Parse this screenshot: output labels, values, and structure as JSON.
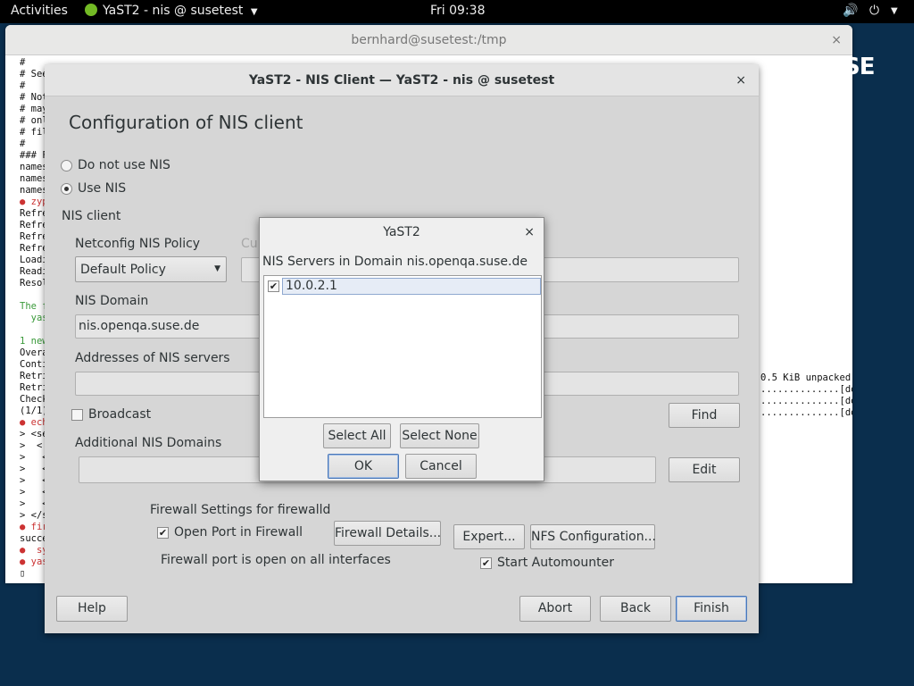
{
  "topbar": {
    "activities": "Activities",
    "app_name": "YaST2 - nis @ susetest",
    "clock": "Fri 09:38"
  },
  "terminal": {
    "title": "bernhard@susetest:/tmp",
    "close": "×",
    "lines": [
      {
        "t": "#",
        "c": ""
      },
      {
        "t": "# See",
        "c": ""
      },
      {
        "t": "#",
        "c": ""
      },
      {
        "t": "# Not",
        "c": ""
      },
      {
        "t": "# may",
        "c": ""
      },
      {
        "t": "# onl",
        "c": ""
      },
      {
        "t": "# fil",
        "c": ""
      },
      {
        "t": "#",
        "c": ""
      },
      {
        "t": "### F",
        "c": ""
      },
      {
        "t": "names",
        "c": ""
      },
      {
        "t": "names",
        "c": ""
      },
      {
        "t": "names",
        "c": ""
      },
      {
        "t": "● zyp",
        "c": "red"
      },
      {
        "t": "Refre",
        "c": ""
      },
      {
        "t": "Refre",
        "c": ""
      },
      {
        "t": "Refre",
        "c": ""
      },
      {
        "t": "Refre",
        "c": ""
      },
      {
        "t": "Loadi",
        "c": ""
      },
      {
        "t": "Readi",
        "c": ""
      },
      {
        "t": "Resol",
        "c": ""
      },
      {
        "t": "",
        "c": ""
      },
      {
        "t": "The f",
        "c": "green"
      },
      {
        "t": "  yas",
        "c": "green"
      },
      {
        "t": "",
        "c": ""
      },
      {
        "t": "1 new",
        "c": "green"
      },
      {
        "t": "Overa",
        "c": ""
      },
      {
        "t": "Conti",
        "c": ""
      },
      {
        "t": "Retri",
        "c": ""
      },
      {
        "t": "Retri",
        "c": ""
      },
      {
        "t": "Check",
        "c": ""
      },
      {
        "t": "(1/1)",
        "c": ""
      },
      {
        "t": "● ech",
        "c": "red"
      },
      {
        "t": "> <se",
        "c": ""
      },
      {
        "t": ">  <",
        "c": ""
      },
      {
        "t": ">   <",
        "c": ""
      },
      {
        "t": ">   <",
        "c": ""
      },
      {
        "t": ">   <",
        "c": ""
      },
      {
        "t": ">   <",
        "c": ""
      },
      {
        "t": ">   <",
        "c": ""
      },
      {
        "t": "> </s",
        "c": ""
      },
      {
        "t": "● fir",
        "c": "red"
      },
      {
        "t": "succe",
        "c": ""
      },
      {
        "t": "●  sy",
        "c": "red"
      },
      {
        "t": "● yas",
        "c": "red"
      },
      {
        "t": "▯",
        "c": ""
      }
    ],
    "right_lines": "0.5 KiB unpacked)\n..............[done]\n..............[done]\n..............[done]",
    "logo": "SE"
  },
  "yast": {
    "title": "YaST2 - NIS Client — YaST2 - nis @ susetest",
    "close": "×",
    "heading": "Configuration of NIS client",
    "radio_no_nis": "Do not use NIS",
    "radio_use_nis": "Use NIS",
    "nis_client_label": "NIS client",
    "netconfig_label": "Netconfig NIS Policy",
    "netconfig_value": "Default Policy",
    "custom_label": "Cu",
    "nis_domain_label": "NIS Domain",
    "nis_domain_value": "nis.openqa.suse.de",
    "addresses_label": "Addresses of NIS servers",
    "broadcast_label": "Broadcast",
    "find_button": "Find",
    "additional_label": "Additional NIS Domains",
    "edit_button": "Edit",
    "firewall_title": "Firewall Settings for firewalld",
    "open_port_label": "Open Port in Firewall",
    "firewall_details": "Firewall Details...",
    "firewall_status": "Firewall port is open on all interfaces",
    "expert_button": "Expert...",
    "nfs_button": "NFS Configuration...",
    "automounter_label": "Start Automounter",
    "help_button": "Help",
    "abort_button": "Abort",
    "back_button": "Back",
    "finish_button": "Finish"
  },
  "dialog": {
    "title": "YaST2",
    "close": "×",
    "list_label": "NIS Servers in Domain nis.openqa.suse.de",
    "servers": [
      "10.0.2.1"
    ],
    "select_all": "Select All",
    "select_none": "Select None",
    "ok": "OK",
    "cancel": "Cancel"
  }
}
